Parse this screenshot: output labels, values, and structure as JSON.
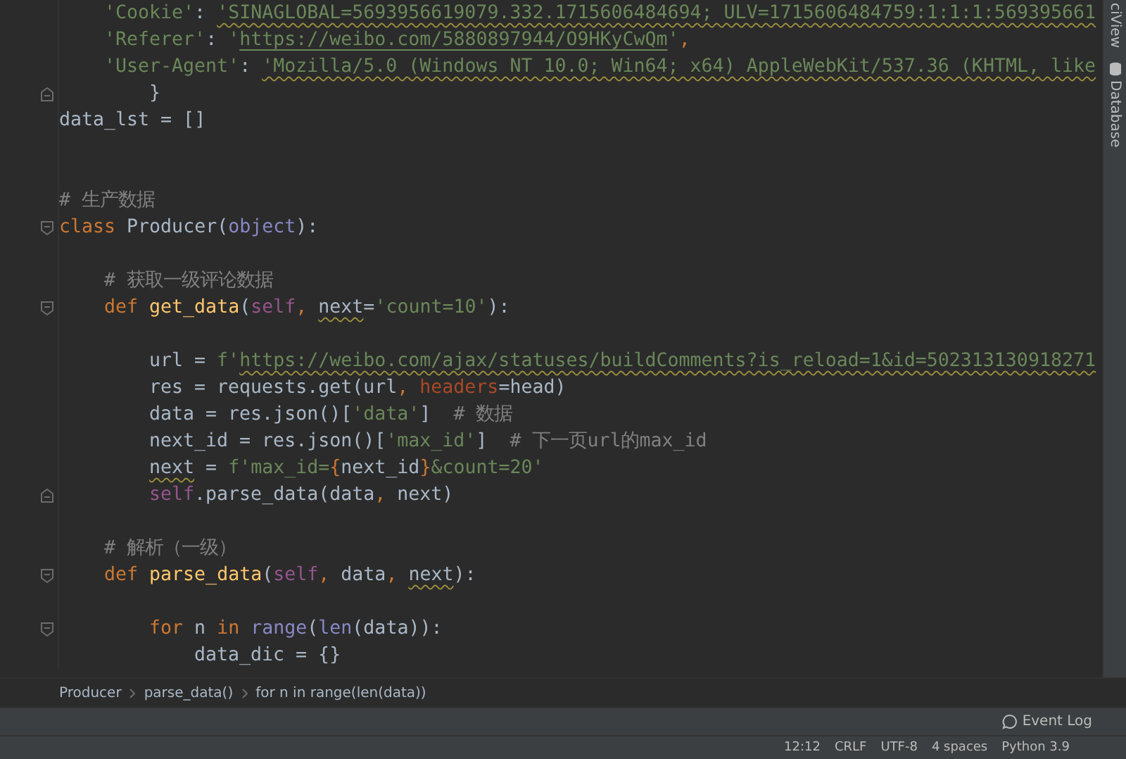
{
  "editor": {
    "lines": [
      {
        "kind": "group",
        "children": [
          {
            "kind": "code",
            "tokens": [
              {
                "text": "'Cookie'",
                "kind": "str"
              },
              {
                "text": ": ",
                "kind": "plain"
              },
              {
                "text": "'SINAGLOBAL=5693956619079.332.1715606484694; ULV=1715606484759:1:1:1:569395661",
                "kind": "str",
                "squiggly": true
              }
            ]
          },
          {
            "kind": "code",
            "tokens": [
              {
                "text": "'Referer'",
                "kind": "str"
              },
              {
                "text": ": ",
                "kind": "plain"
              },
              {
                "text": "'",
                "kind": "str"
              },
              {
                "text": "https://weibo.com/5880897944/O9HKyCwQm",
                "kind": "str",
                "link": true
              },
              {
                "text": "'",
                "kind": "str"
              },
              {
                "text": ",",
                "kind": "punct"
              }
            ]
          },
          {
            "kind": "code",
            "tokens": [
              {
                "text": "'User-Agent'",
                "kind": "str"
              },
              {
                "text": ": ",
                "kind": "plain"
              },
              {
                "text": "'Mozilla/5.0 (Windows NT 10.0; Win64; x64) AppleWebKit/537.36 (KHTML, like",
                "kind": "str",
                "squiggly": true
              }
            ]
          },
          {
            "kind": "group",
            "children": [
              {
                "kind": "code",
                "fold_end": true,
                "tokens": [
                  {
                    "text": "}",
                    "kind": "plain"
                  }
                ]
              }
            ]
          }
        ]
      },
      {
        "kind": "code",
        "tokens": [
          {
            "text": "data_lst = []",
            "kind": "plain"
          }
        ]
      },
      {
        "kind": "blank"
      },
      {
        "kind": "blank"
      },
      {
        "kind": "code",
        "tokens": [
          {
            "text": "# 生产数据",
            "kind": "comment"
          }
        ]
      },
      {
        "kind": "code",
        "fold_start": true,
        "tokens": [
          {
            "text": "class",
            "kind": "keyword"
          },
          {
            "text": " Producer(",
            "kind": "plain"
          },
          {
            "text": "object",
            "kind": "builtin"
          },
          {
            "text": "):",
            "kind": "plain"
          }
        ],
        "children": [
          {
            "kind": "blank"
          },
          {
            "kind": "code",
            "tokens": [
              {
                "text": "# 获取一级评论数据",
                "kind": "comment"
              }
            ]
          },
          {
            "kind": "code",
            "fold_start": true,
            "tokens": [
              {
                "text": "def ",
                "kind": "keyword"
              },
              {
                "text": "get_data",
                "kind": "function"
              },
              {
                "text": "(",
                "kind": "plain"
              },
              {
                "text": "self",
                "kind": "self"
              },
              {
                "text": ", ",
                "kind": "punct"
              },
              {
                "text": "next",
                "kind": "plain",
                "squiggly": true
              },
              {
                "text": "=",
                "kind": "plain"
              },
              {
                "text": "'count=10'",
                "kind": "str"
              },
              {
                "text": "):",
                "kind": "plain"
              }
            ],
            "children": [
              {
                "kind": "blank"
              },
              {
                "kind": "code",
                "tokens": [
                  {
                    "text": "url = ",
                    "kind": "plain"
                  },
                  {
                    "text": "f'",
                    "kind": "str"
                  },
                  {
                    "text": "https://weibo.com/ajax/statuses/buildComments?is_reload=1&id=502313130918271",
                    "kind": "str",
                    "squiggly": true
                  }
                ]
              },
              {
                "kind": "code",
                "tokens": [
                  {
                    "text": "res = requests.get(url",
                    "kind": "plain"
                  },
                  {
                    "text": ", ",
                    "kind": "punct"
                  },
                  {
                    "text": "headers",
                    "kind": "param"
                  },
                  {
                    "text": "=head)",
                    "kind": "plain"
                  }
                ]
              },
              {
                "kind": "code",
                "tokens": [
                  {
                    "text": "data = res.json()[",
                    "kind": "plain"
                  },
                  {
                    "text": "'data'",
                    "kind": "str"
                  },
                  {
                    "text": "]  ",
                    "kind": "plain"
                  },
                  {
                    "text": "# 数据",
                    "kind": "comment"
                  }
                ]
              },
              {
                "kind": "code",
                "tokens": [
                  {
                    "text": "next_id = res.json()[",
                    "kind": "plain"
                  },
                  {
                    "text": "'max_id'",
                    "kind": "str"
                  },
                  {
                    "text": "]  ",
                    "kind": "plain"
                  },
                  {
                    "text": "# 下一页url的max_id",
                    "kind": "comment"
                  }
                ]
              },
              {
                "kind": "code",
                "tokens": [
                  {
                    "text": "next",
                    "kind": "plain",
                    "squiggly": true
                  },
                  {
                    "text": " = ",
                    "kind": "plain"
                  },
                  {
                    "text": "f'max_id=",
                    "kind": "str"
                  },
                  {
                    "text": "{",
                    "kind": "punct"
                  },
                  {
                    "text": "next_id",
                    "kind": "plain"
                  },
                  {
                    "text": "}",
                    "kind": "punct"
                  },
                  {
                    "text": "&count=20'",
                    "kind": "str"
                  }
                ]
              },
              {
                "kind": "code",
                "fold_end": true,
                "tokens": [
                  {
                    "text": "self",
                    "kind": "self"
                  },
                  {
                    "text": ".parse_data(data",
                    "kind": "plain"
                  },
                  {
                    "text": ", ",
                    "kind": "punct"
                  },
                  {
                    "text": "next)",
                    "kind": "plain"
                  }
                ]
              }
            ]
          },
          {
            "kind": "blank"
          },
          {
            "kind": "code",
            "tokens": [
              {
                "text": "# 解析（一级）",
                "kind": "comment"
              }
            ]
          },
          {
            "kind": "code",
            "fold_start": true,
            "tokens": [
              {
                "text": "def ",
                "kind": "keyword"
              },
              {
                "text": "parse_data",
                "kind": "function"
              },
              {
                "text": "(",
                "kind": "plain"
              },
              {
                "text": "self",
                "kind": "self"
              },
              {
                "text": ", ",
                "kind": "punct"
              },
              {
                "text": "data",
                "kind": "plain"
              },
              {
                "text": ", ",
                "kind": "punct"
              },
              {
                "text": "next",
                "kind": "plain",
                "squiggly": true
              },
              {
                "text": "):",
                "kind": "plain"
              }
            ],
            "children": [
              {
                "kind": "blank"
              },
              {
                "kind": "code",
                "fold_start": true,
                "tokens": [
                  {
                    "text": "for",
                    "kind": "keyword"
                  },
                  {
                    "text": " n ",
                    "kind": "plain"
                  },
                  {
                    "text": "in ",
                    "kind": "keyword"
                  },
                  {
                    "text": "range",
                    "kind": "builtin"
                  },
                  {
                    "text": "(",
                    "kind": "plain"
                  },
                  {
                    "text": "len",
                    "kind": "builtin"
                  },
                  {
                    "text": "(data)):",
                    "kind": "plain"
                  }
                ],
                "children": [
                  {
                    "kind": "code",
                    "tokens": [
                      {
                        "text": "data_dic = {}",
                        "kind": "plain"
                      }
                    ]
                  }
                ]
              }
            ]
          }
        ]
      }
    ]
  },
  "side_tools": [
    {
      "label": "ciView",
      "kind": "plain"
    },
    {
      "label": "Database",
      "kind": "database"
    }
  ],
  "breadcrumbs": [
    "Producer",
    "parse_data()",
    "for n in range(len(data))"
  ],
  "event_log": {
    "label": "Event Log"
  },
  "status_bar": [
    "12:12",
    "CRLF",
    "UTF-8",
    "4 spaces",
    "Python 3.9"
  ]
}
